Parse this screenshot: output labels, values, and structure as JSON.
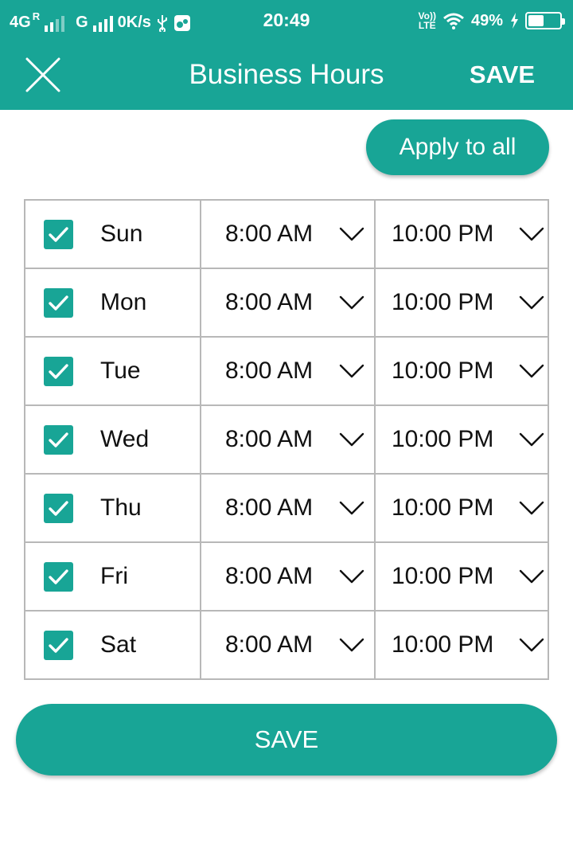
{
  "status_bar": {
    "network_1": "4G",
    "roaming": "R",
    "network_2": "G",
    "speed": "0K/s",
    "time": "20:49",
    "volte_top": "Vo))",
    "volte_bottom": "LTE",
    "battery": "49%",
    "battery_level": 0.49
  },
  "toolbar": {
    "title": "Business Hours",
    "save_label": "SAVE"
  },
  "apply_all_label": "Apply to all",
  "days": [
    {
      "name": "Sun",
      "checked": true,
      "open": "8:00 AM",
      "close": "10:00 PM"
    },
    {
      "name": "Mon",
      "checked": true,
      "open": "8:00 AM",
      "close": "10:00 PM"
    },
    {
      "name": "Tue",
      "checked": true,
      "open": "8:00 AM",
      "close": "10:00 PM"
    },
    {
      "name": "Wed",
      "checked": true,
      "open": "8:00 AM",
      "close": "10:00 PM"
    },
    {
      "name": "Thu",
      "checked": true,
      "open": "8:00 AM",
      "close": "10:00 PM"
    },
    {
      "name": "Fri",
      "checked": true,
      "open": "8:00 AM",
      "close": "10:00 PM"
    },
    {
      "name": "Sat",
      "checked": true,
      "open": "8:00 AM",
      "close": "10:00 PM"
    }
  ],
  "save_button_label": "SAVE",
  "colors": {
    "accent": "#18a596",
    "border": "#b8b8b8",
    "text": "#111111"
  },
  "icons": [
    "close-icon",
    "checkbox-checked-icon",
    "chevron-down-icon",
    "usb-icon",
    "wifi-icon",
    "battery-icon",
    "charging-icon"
  ]
}
